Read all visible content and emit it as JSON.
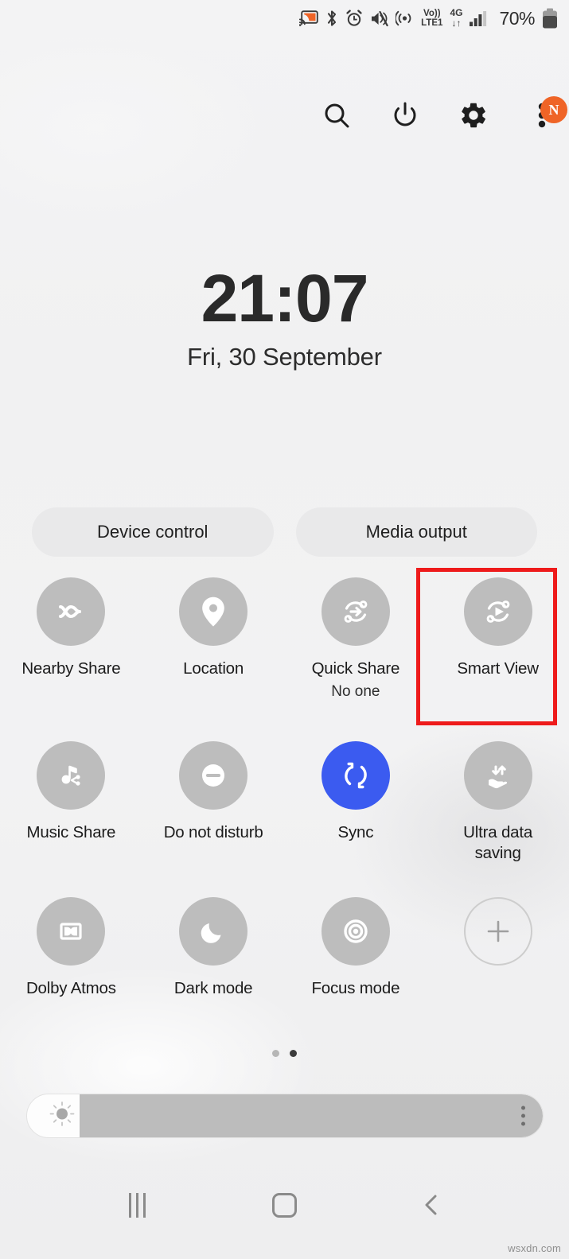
{
  "status_bar": {
    "icons": [
      "screen-cast-icon",
      "bluetooth-icon",
      "alarm-icon",
      "mute-icon",
      "hotspot-icon"
    ],
    "volte_top": "Vo))",
    "volte_bottom": "LTE1",
    "network_type": "4G",
    "data_arrows": "↓↑",
    "battery_percent": "70%"
  },
  "header": {
    "search_label": "search-icon",
    "power_label": "power-icon",
    "settings_label": "gear-icon",
    "overflow_label": "more-options-icon",
    "avatar_initial": "N",
    "avatar_color": "#ef6427"
  },
  "clock": {
    "time": "21:07",
    "date": "Fri, 30 September"
  },
  "pills": [
    {
      "label": "Device control"
    },
    {
      "label": "Media output"
    }
  ],
  "toggles": [
    {
      "label": "Nearby Share",
      "sub": "",
      "icon": "nearby-share-icon",
      "state": "off"
    },
    {
      "label": "Location",
      "sub": "",
      "icon": "location-pin-icon",
      "state": "off"
    },
    {
      "label": "Quick Share",
      "sub": "No one",
      "icon": "quick-share-icon",
      "state": "off"
    },
    {
      "label": "Smart View",
      "sub": "",
      "icon": "smart-view-icon",
      "state": "off",
      "highlighted": true
    },
    {
      "label": "Music Share",
      "sub": "",
      "icon": "music-share-icon",
      "state": "off"
    },
    {
      "label": "Do not disturb",
      "sub": "",
      "icon": "do-not-disturb-icon",
      "state": "off"
    },
    {
      "label": "Sync",
      "sub": "",
      "icon": "sync-icon",
      "state": "on"
    },
    {
      "label": "Ultra data saving",
      "sub": "",
      "icon": "ultra-data-saving-icon",
      "state": "off"
    },
    {
      "label": "Dolby Atmos",
      "sub": "",
      "icon": "dolby-atmos-icon",
      "state": "off"
    },
    {
      "label": "Dark mode",
      "sub": "",
      "icon": "dark-mode-moon-icon",
      "state": "off"
    },
    {
      "label": "Focus mode",
      "sub": "",
      "icon": "focus-mode-icon",
      "state": "off"
    },
    {
      "label": "",
      "sub": "",
      "icon": "add-button-icon",
      "state": "add"
    }
  ],
  "pagination": {
    "total": 2,
    "active_index": 1
  },
  "brightness": {
    "name": "brightness-slider",
    "fill_percent": 10
  },
  "navbar": {
    "recents": "recents-icon",
    "home": "home-icon",
    "back": "back-icon"
  },
  "watermark": "wsxdn.com",
  "colors": {
    "background": "#f2f2f3",
    "toggle_off": "#bdbdbd",
    "toggle_on": "#3b5bf0",
    "highlight": "#ee1b1b",
    "pill": "#e9e9ea"
  }
}
